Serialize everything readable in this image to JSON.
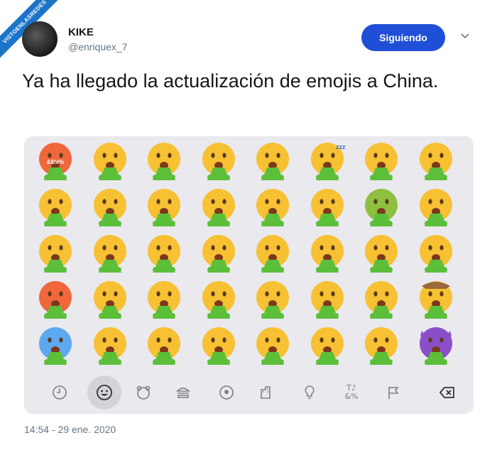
{
  "watermark": "VISTOENLASREDES",
  "author": {
    "name": "KIKE",
    "handle": "@enriquex_7"
  },
  "follow_button": "Siguiendo",
  "tweet_text": "Ya ha llegado la actualización de emojis a China.",
  "timestamp": "14:54 - 29 ene. 2020",
  "keyboard": {
    "grawlix_text": "&$!#%",
    "zzz_text": "zzz",
    "rows": [
      [
        "angry-grawlix",
        "screaming",
        "vomit-hands",
        "vomit",
        "vomit",
        "sleeping-vomit",
        "drooling-vomit",
        "thermometer-vomit"
      ],
      [
        "exploding-vomit",
        "cold-sweat-vomit",
        "tongue-vomit",
        "vomit",
        "vomit",
        "relieved-vomit",
        "nauseated-vomit",
        "bandage-vomit"
      ],
      [
        "flushed-vomit",
        "anxious-vomit",
        "hand-over-mouth-vomit",
        "neutral-vomit",
        "vomit",
        "sad-tear-vomit",
        "dizzy-vomit",
        "money-vomit"
      ],
      [
        "pouting-vomit",
        "worried-sweat-vomit",
        "zipper-vomit",
        "grimace-vomit",
        "vomit",
        "x-eyes-vomit",
        "sneeze-vomit",
        "cowboy-vomit"
      ],
      [
        "freezing-vomit",
        "downcast-sweat-vomit",
        "lying-vomit",
        "rolling-eyes-vomit",
        "vomit",
        "zipper-mouth-vomit",
        "mask-vomit",
        "devil-vomit"
      ]
    ],
    "toolbar": [
      "clock-icon",
      "smiley-icon",
      "bear-icon",
      "burger-icon",
      "soccer-ball-icon",
      "city-icon",
      "lightbulb-icon",
      "symbols-icon",
      "flag-icon",
      "delete-icon"
    ],
    "symbols_label": "T♪ &%"
  },
  "colors": {
    "follow": "#1f4fd6",
    "vomit": "#5cbf3a",
    "face": "#f7c133",
    "keyboard_bg": "#e9e9ee"
  }
}
